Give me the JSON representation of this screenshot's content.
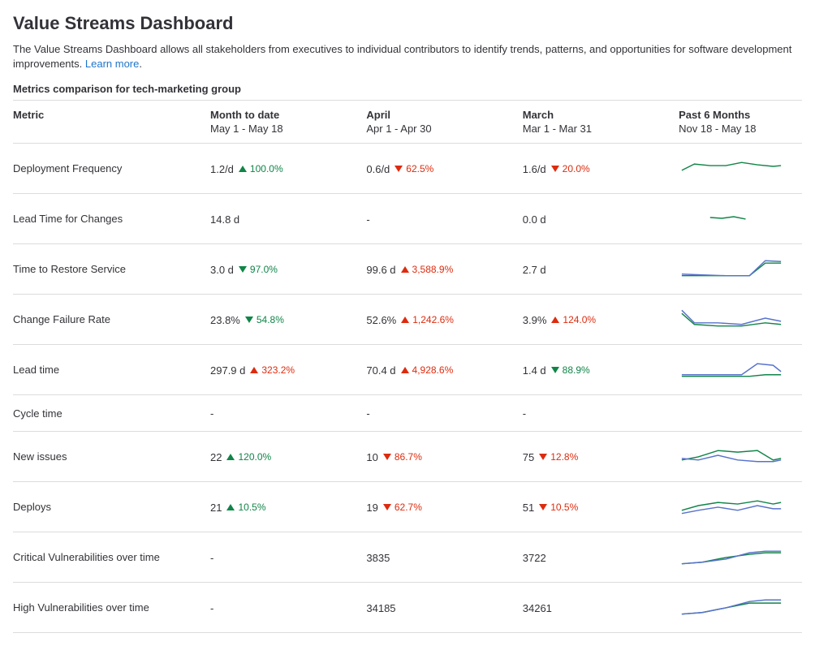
{
  "title": "Value Streams Dashboard",
  "description": "The Value Streams Dashboard allows all stakeholders from executives to individual contributors to identify trends, patterns, and opportunities for software development improvements.",
  "learn_more": "Learn more",
  "subhead": "Metrics comparison for tech-marketing group",
  "columns": {
    "metric": "Metric",
    "mtd": {
      "label": "Month to date",
      "range": "May 1 - May 18"
    },
    "april": {
      "label": "April",
      "range": "Apr 1 - Apr 30"
    },
    "march": {
      "label": "March",
      "range": "Mar 1 - Mar 31"
    },
    "past6": {
      "label": "Past 6 Months",
      "range": "Nov 18 - May 18"
    }
  },
  "rows": [
    {
      "name": "Deployment Frequency",
      "mtd": {
        "value": "1.2/d",
        "dir": "up",
        "sent": "good",
        "pct": "100.0%"
      },
      "april": {
        "value": "0.6/d",
        "dir": "down",
        "sent": "bad",
        "pct": "62.5%"
      },
      "march": {
        "value": "1.6/d",
        "dir": "down",
        "sent": "bad",
        "pct": "20.0%"
      },
      "spark": {
        "s1": "4,18 20,10 40,12 60,12 80,8 100,11 120,13 130,12",
        "s2": ""
      }
    },
    {
      "name": "Lead Time for Changes",
      "mtd": {
        "value": "14.8 d"
      },
      "april": {
        "value": "-"
      },
      "march": {
        "value": "0.0 d"
      },
      "spark": {
        "s1": "40,14 55,15 70,13 85,16",
        "s2": ""
      }
    },
    {
      "name": "Time to Restore Service",
      "mtd": {
        "value": "3.0 d",
        "dir": "down",
        "sent": "good",
        "pct": "97.0%"
      },
      "april": {
        "value": "99.6 d",
        "dir": "up",
        "sent": "bad",
        "pct": "3,588.9%"
      },
      "march": {
        "value": "2.7 d"
      },
      "spark": {
        "s1": "4,24 30,24 60,24 90,24 110,8 130,8",
        "s2": "4,22 30,23 60,24 90,24 110,5 130,6"
      }
    },
    {
      "name": "Change Failure Rate",
      "mtd": {
        "value": "23.8%",
        "dir": "down",
        "sent": "good",
        "pct": "54.8%"
      },
      "april": {
        "value": "52.6%",
        "dir": "up",
        "sent": "bad",
        "pct": "1,242.6%"
      },
      "march": {
        "value": "3.9%",
        "dir": "up",
        "sent": "bad",
        "pct": "124.0%"
      },
      "spark": {
        "s1": "4,8 20,22 50,24 80,24 110,20 130,22",
        "s2": "4,4 20,20 50,20 80,22 110,14 130,18"
      }
    },
    {
      "name": "Lead time",
      "mtd": {
        "value": "297.9 d",
        "dir": "up",
        "sent": "bad",
        "pct": "323.2%"
      },
      "april": {
        "value": "70.4 d",
        "dir": "up",
        "sent": "bad",
        "pct": "4,928.6%"
      },
      "march": {
        "value": "1.4 d",
        "dir": "down",
        "sent": "good",
        "pct": "88.9%"
      },
      "spark": {
        "s1": "4,24 30,24 60,24 90,24 110,22 130,22",
        "s2": "4,22 30,22 60,22 80,22 100,8 120,10 130,18"
      }
    },
    {
      "name": "Cycle time",
      "mtd": {
        "value": "-"
      },
      "april": {
        "value": "-"
      },
      "march": {
        "value": "-"
      },
      "spark": null
    },
    {
      "name": "New issues",
      "mtd": {
        "value": "22",
        "dir": "up",
        "sent": "good",
        "pct": "120.0%"
      },
      "april": {
        "value": "10",
        "dir": "down",
        "sent": "bad",
        "pct": "86.7%"
      },
      "march": {
        "value": "75",
        "dir": "down",
        "sent": "bad",
        "pct": "12.8%"
      },
      "spark": {
        "s1": "4,20 25,16 50,8 75,10 100,8 120,20 130,18",
        "s2": "4,18 25,20 50,14 75,20 100,22 120,22 130,20"
      }
    },
    {
      "name": "Deploys",
      "mtd": {
        "value": "21",
        "dir": "up",
        "sent": "good",
        "pct": "10.5%"
      },
      "april": {
        "value": "19",
        "dir": "down",
        "sent": "bad",
        "pct": "62.7%"
      },
      "march": {
        "value": "51",
        "dir": "down",
        "sent": "bad",
        "pct": "10.5%"
      },
      "spark": {
        "s1": "4,20 25,14 50,10 75,12 100,8 120,12 130,10",
        "s2": "4,24 25,20 50,16 75,20 100,14 120,18 130,18"
      }
    },
    {
      "name": "Critical Vulnerabilities over time",
      "mtd": {
        "value": "-"
      },
      "april": {
        "value": "3835"
      },
      "march": {
        "value": "3722"
      },
      "spark": {
        "s1": "4,24 30,22 60,16 90,12 110,10 130,10",
        "s2": "4,24 30,22 60,18 90,10 110,8 130,8"
      }
    },
    {
      "name": "High Vulnerabilities over time",
      "mtd": {
        "value": "-"
      },
      "april": {
        "value": "34185"
      },
      "march": {
        "value": "34261"
      },
      "spark": {
        "s1": "4,24 30,22 60,16 90,10 110,10 130,10",
        "s2": "4,24 30,22 60,16 90,8 110,6 130,6"
      }
    }
  ]
}
